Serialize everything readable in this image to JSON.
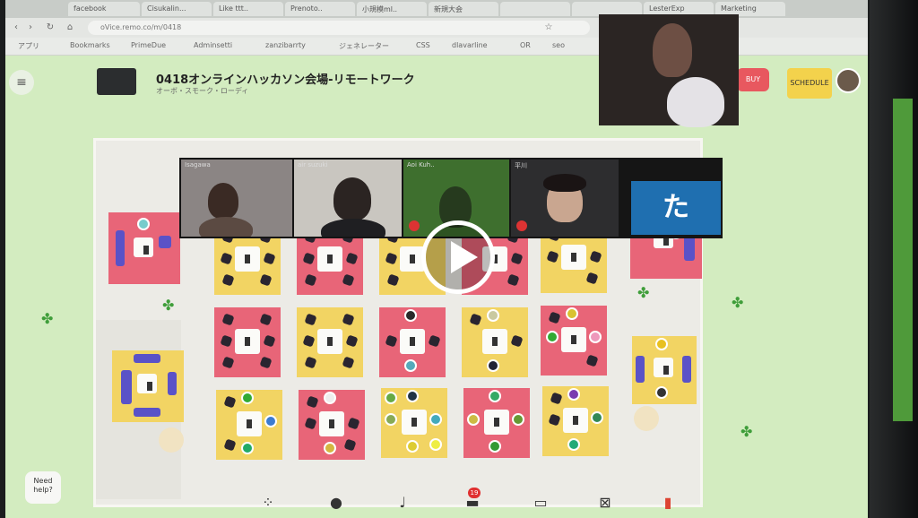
{
  "browser": {
    "url": "oVice.remo.co/m/0418",
    "tabs": [
      "facebook",
      "Cisukalin...",
      "Like ttt..",
      "Prenoto..",
      "小規模ml..",
      "新規大会",
      "",
      "",
      "LesterExp",
      "Marketing"
    ],
    "bookmarks": [
      "アプリ",
      "Bookmarks",
      "PrimeDue",
      "Adminsetti",
      "zanzibarrty",
      "ジェネレーター",
      "CSS",
      "dlavarline",
      "OR",
      "seo"
    ]
  },
  "room": {
    "title": "0418オンラインハッカソン会場-リモートワーク",
    "subtitle": "オーボ・スモーク・ローディ"
  },
  "header": {
    "badge_red": "BUY",
    "badge_yellow": "SCHEDULE"
  },
  "video": {
    "participants": [
      {
        "name": "Isagawa",
        "muted": false
      },
      {
        "name": "air suzuki",
        "muted": false
      },
      {
        "name": "Aoi Kuh..",
        "muted": true
      },
      {
        "name": "平川",
        "muted": true
      }
    ],
    "local_tile_text": "た"
  },
  "floor": {
    "tables": [
      {
        "color": "#f2d463"
      },
      {
        "color": "#e86578"
      },
      {
        "color": "#f2d463"
      },
      {
        "color": "#e86578"
      },
      {
        "color": "#f2d463"
      },
      {
        "color": "#e86578"
      },
      {
        "color": "#f2d463"
      },
      {
        "color": "#e86578"
      },
      {
        "color": "#f2d463"
      },
      {
        "color": "#e86578"
      },
      {
        "color": "#f2d463"
      },
      {
        "color": "#e86578"
      },
      {
        "color": "#f2d463"
      },
      {
        "color": "#e86578"
      },
      {
        "color": "#f2d463"
      }
    ]
  },
  "help": {
    "label_line1": "Need",
    "label_line2": "help?"
  },
  "toolbar": {
    "chat_count": "19"
  },
  "colors": {
    "floor_yellow": "#f2d463",
    "floor_pink": "#e86578",
    "app_background": "#d3ecc0",
    "sofa_purple": "#5a52c7"
  }
}
